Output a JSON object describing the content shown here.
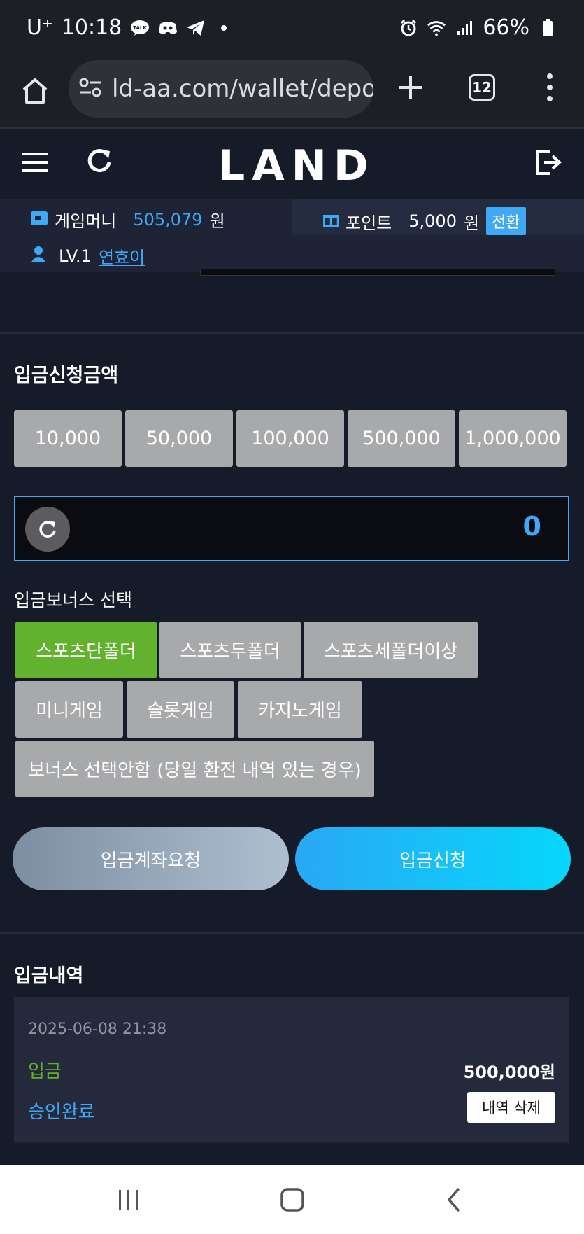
{
  "status_bar": {
    "carrier": "U⁺",
    "time": "10:18",
    "talk_badge": "TALK",
    "battery": "66%"
  },
  "browser": {
    "url": "ld-aa.com/wallet/depos",
    "tab_count": "12"
  },
  "header": {
    "logo": "LAND"
  },
  "account": {
    "money_label": "게임머니",
    "money_value": "505,079",
    "money_unit": "원",
    "point_label": "포인트",
    "point_value": "5,000",
    "point_unit": "원",
    "convert_label": "전환",
    "level": "LV.1",
    "nickname": "연효이"
  },
  "deposit": {
    "title": "입금신청금액",
    "amount_buttons": [
      "10,000",
      "50,000",
      "100,000",
      "500,000",
      "1,000,000"
    ],
    "amount_value": "0",
    "bonus_title": "입금보너스 선택",
    "bonus_options": [
      "스포츠단폴더",
      "스포츠두폴더",
      "스포츠세폴더이상",
      "미니게임",
      "슬롯게임",
      "카지노게임",
      "보너스 선택안함 (당일 환전 내역 있는 경우)"
    ],
    "selected_bonus": "스포츠단폴더",
    "account_request_label": "입금계좌요청",
    "submit_label": "입금신청"
  },
  "history": {
    "title": "입금내역",
    "items": [
      {
        "date": "2025-06-08 21:38",
        "type": "입금",
        "amount": "500,000원",
        "status": "승인완료",
        "delete_label": "내역 삭제"
      }
    ]
  },
  "colors": {
    "background": "#161b2a",
    "accent_blue": "#3fa9f5",
    "active_green": "#62b22f",
    "button_gray": "#a8a9ab"
  }
}
